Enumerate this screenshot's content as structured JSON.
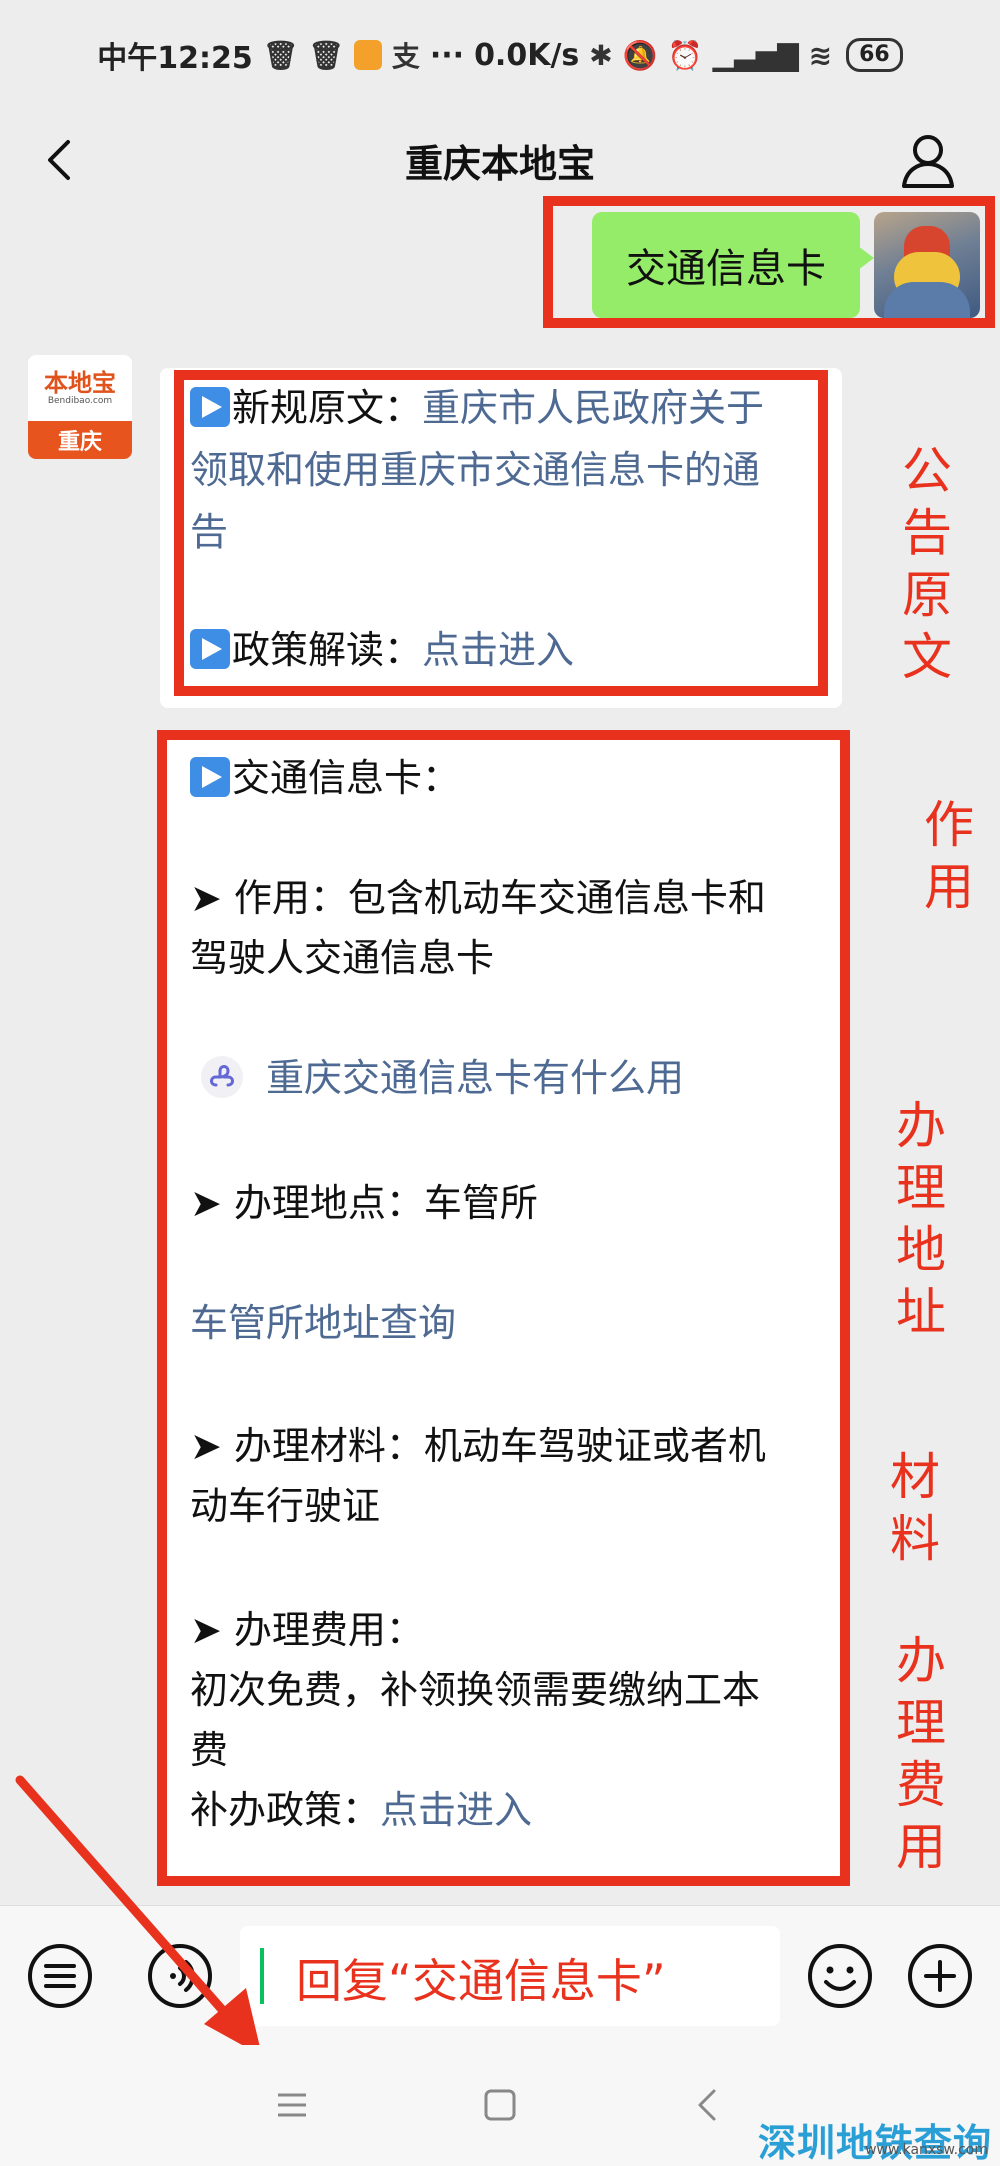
{
  "status_bar": {
    "time": "中午12:25",
    "network_speed": "0.0K/s",
    "battery": "66",
    "alipay_glyph": "支",
    "dots": "···"
  },
  "header": {
    "title": "重庆本地宝",
    "back_icon": "chevron-left-icon",
    "profile_icon": "person-icon"
  },
  "outgoing_message": {
    "text": "交通信息卡"
  },
  "official_account_avatar": {
    "brand": "本地宝",
    "domain": "Bendibao.com",
    "city": "重庆"
  },
  "message_1": {
    "line1_label": "新规原文：",
    "line1_link": "重庆市人民政府关于",
    "line2_link": "领取和使用重庆市交通信息卡的通",
    "line3_link": "告",
    "line4_label": "政策解读：",
    "line4_link": "点击进入"
  },
  "message_2": {
    "heading": "交通信息卡：",
    "usage_line1": "➤ 作用：包含机动车交通信息卡和",
    "usage_line2": "驾驶人交通信息卡",
    "mini_program_link": "重庆交通信息卡有什么用",
    "location_line": "➤ 办理地点：车管所",
    "location_link": "车管所地址查询",
    "materials_line1": "➤ 办理材料：机动车驾驶证或者机",
    "materials_line2": "动车行驶证",
    "fee_line1": "➤ 办理费用：",
    "fee_line2": "初次免费，补领换领需要缴纳工本",
    "fee_line3": "费",
    "reissue_label": "补办政策：",
    "reissue_link": "点击进入"
  },
  "annotations": {
    "announcement": "公告原文",
    "usage": "作用",
    "address": "办理地址",
    "materials": "材料",
    "fee": "办理费用"
  },
  "input_bar": {
    "reply_hint": "回复“交通信息卡”"
  },
  "watermark": {
    "cn": "深圳地铁查询",
    "en": "www.kanxsw.com"
  },
  "colors": {
    "accent_red": "#e9321e",
    "bubble_green": "#95ec69",
    "link_blue": "#4e6a93",
    "background": "#ededed"
  }
}
